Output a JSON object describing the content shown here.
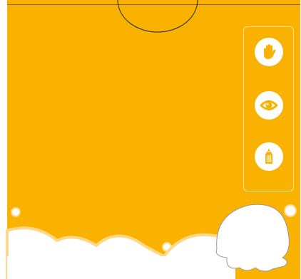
{
  "theme": {
    "background": "#F9B200",
    "panel_border": "#FFE6A8",
    "icon_fill": "#F9B200",
    "cloud_fill": "#FFFFFF",
    "cloud_outline": "#FDD88A"
  },
  "toolbar": {
    "tools": [
      {
        "icon": "hand-icon",
        "label": ""
      },
      {
        "icon": "eye-icon",
        "label": ""
      },
      {
        "icon": "pencil-icon",
        "label": ""
      }
    ]
  }
}
